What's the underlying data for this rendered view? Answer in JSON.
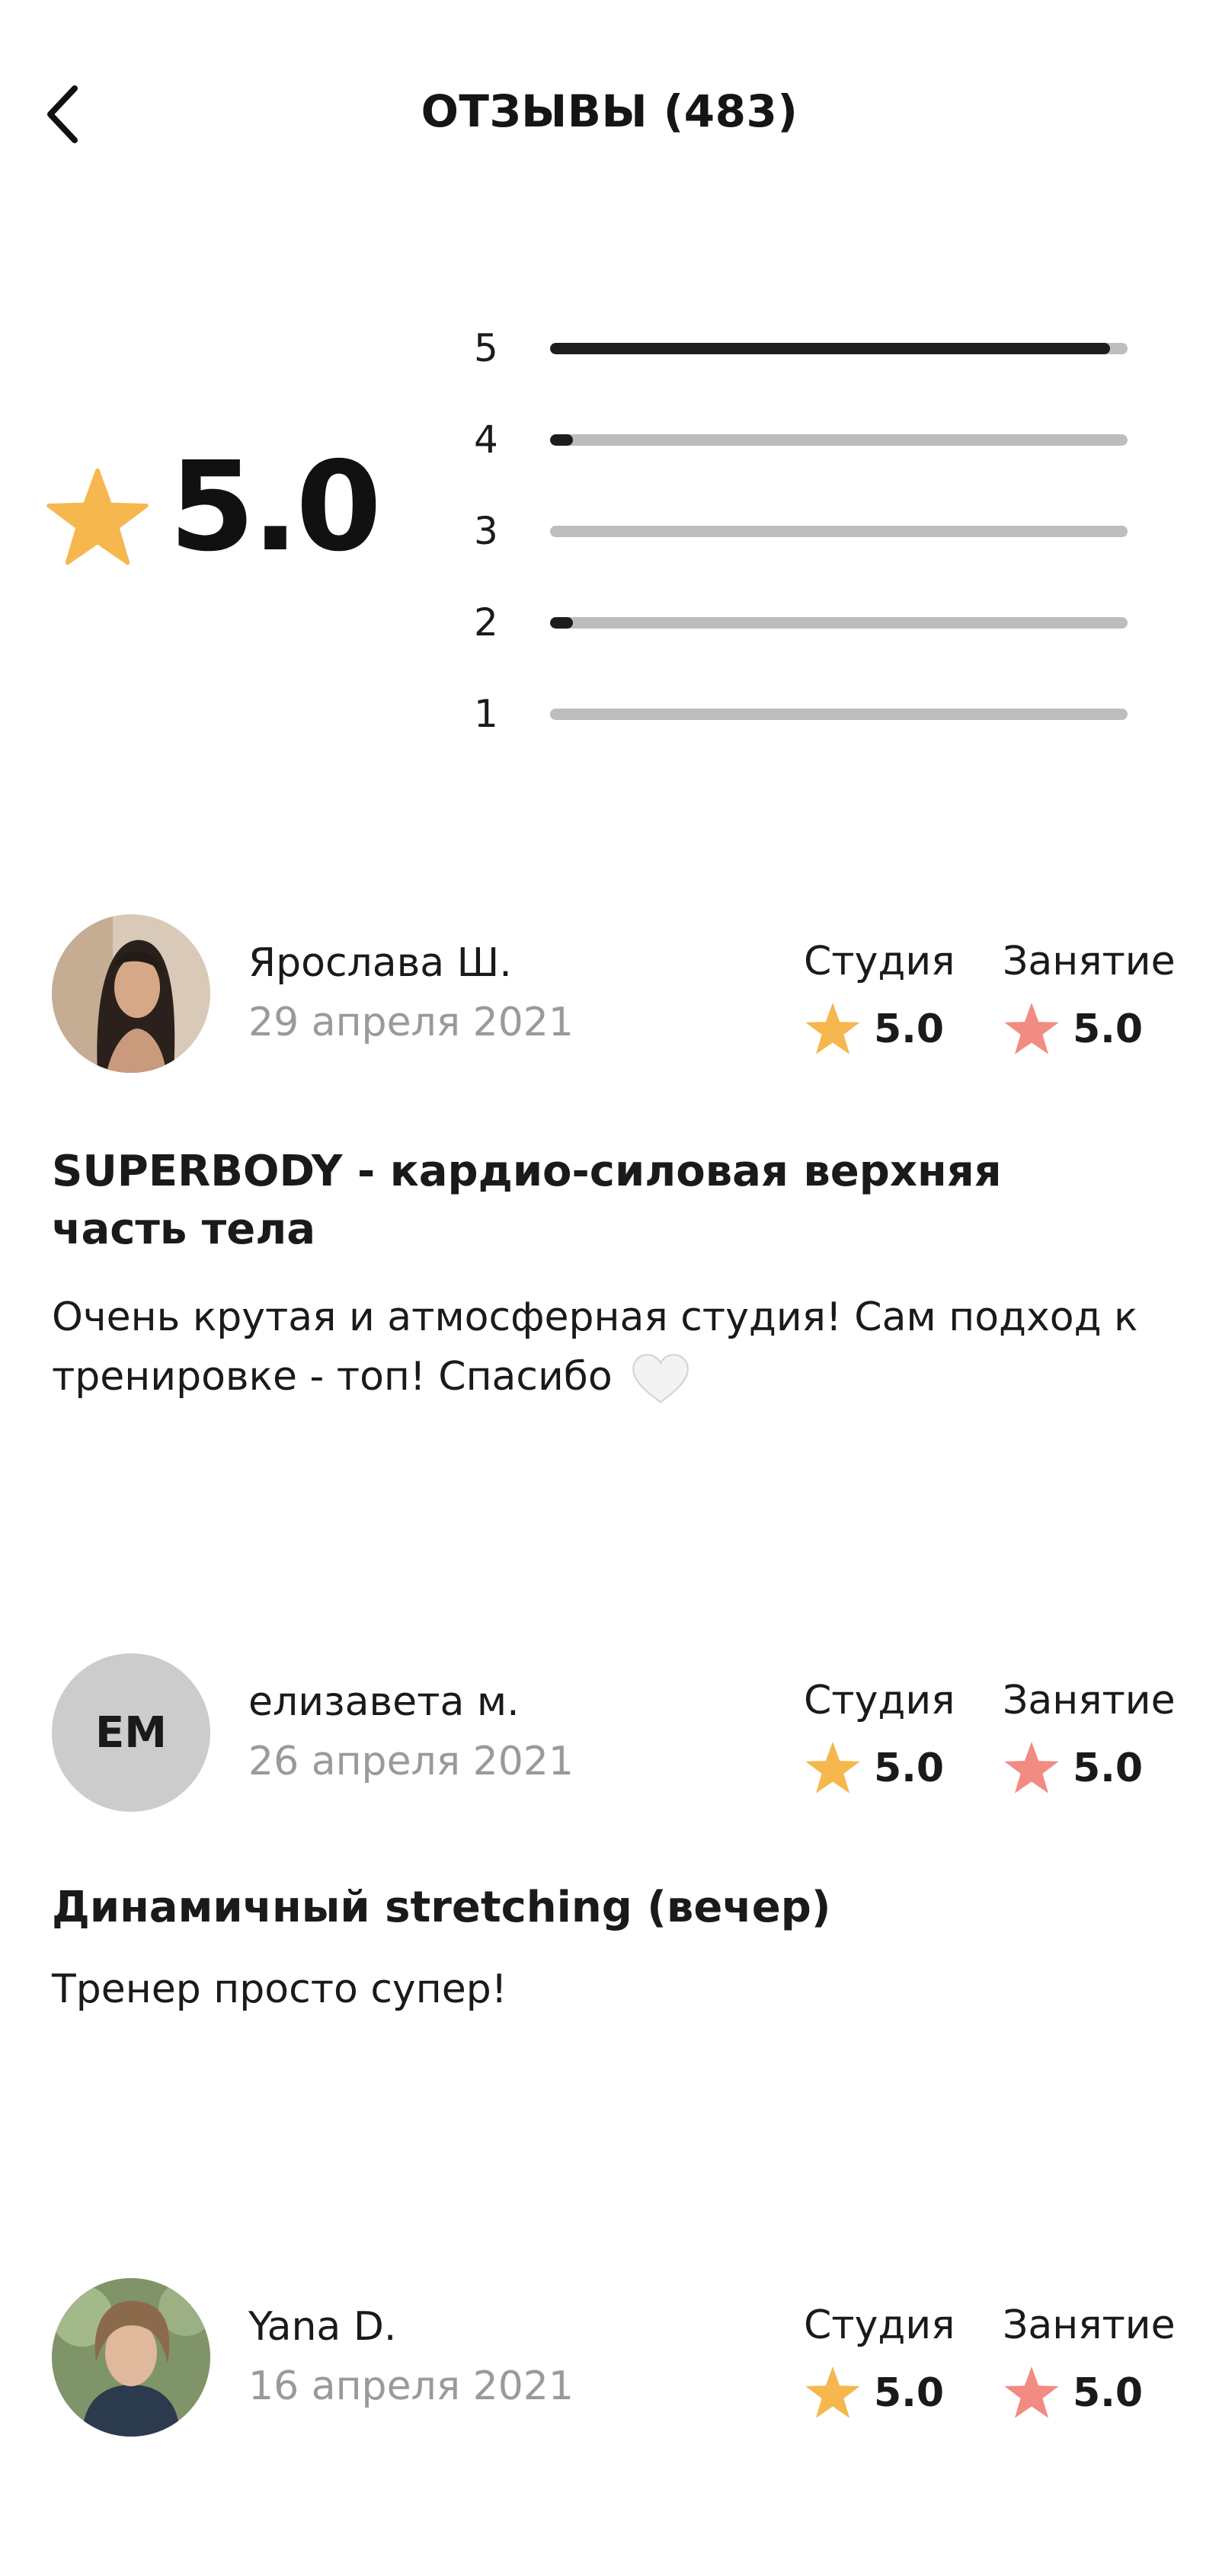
{
  "header": {
    "title": "ОТЗЫВЫ (483)",
    "back_icon": "chevron-left-icon"
  },
  "summary": {
    "average": "5.0",
    "star_color": "#F5B74E",
    "distribution": [
      {
        "label": "5",
        "fraction": 0.97
      },
      {
        "label": "4",
        "fraction": 0.04
      },
      {
        "label": "3",
        "fraction": 0.0
      },
      {
        "label": "2",
        "fraction": 0.04
      },
      {
        "label": "1",
        "fraction": 0.0
      }
    ]
  },
  "colors": {
    "studio_star": "#F5B74E",
    "class_star": "#F28B82",
    "date_gray": "#9A9A9A",
    "track_gray": "#BDBDBD",
    "fill_dark": "#1C1C1C"
  },
  "reviews": [
    {
      "author": "Ярослава Ш.",
      "date": "29 апреля 2021",
      "avatar": "photo",
      "studio_label": "Студия",
      "studio_rating": "5.0",
      "class_label": "Занятие",
      "class_rating": "5.0",
      "class_title": "SUPERBODY - кардио-силовая верхняя часть тела",
      "text": "Очень крутая и атмосферная студия! Сам подход к тренировке - топ! Спасибо",
      "emoji": "white-heart-icon"
    },
    {
      "author": "елизавета м.",
      "date": "26 апреля 2021",
      "avatar_initials": "EM",
      "studio_label": "Студия",
      "studio_rating": "5.0",
      "class_label": "Занятие",
      "class_rating": "5.0",
      "class_title": "Динамичный stretching (вечер)",
      "text": "Тренер просто супер!"
    },
    {
      "author": "Yana D.",
      "date": "16 апреля 2021",
      "avatar": "photo",
      "studio_label": "Студия",
      "studio_rating": "5.0",
      "class_label": "Занятие",
      "class_rating": "5.0"
    }
  ]
}
